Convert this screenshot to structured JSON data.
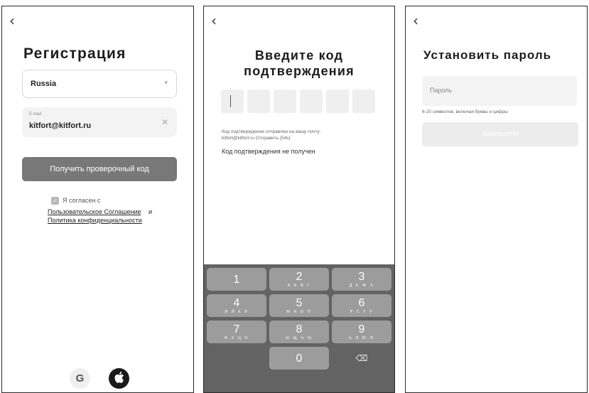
{
  "screen1": {
    "back_icon": "chevron-left-icon",
    "title": "Регистрация",
    "country": "Russia",
    "email_label": "E-mail",
    "email_value": "kitfort@kitfort.ru",
    "get_code_button": "Получить проверочный код",
    "agree_text": "Я согласен с",
    "user_agreement_link": "Пользовательское Соглашение",
    "and_text": "и",
    "privacy_policy_link": "Политика конфиденциальности",
    "google_icon_glyph": "G",
    "apple_icon": "apple-icon"
  },
  "screen2": {
    "back_icon": "chevron-left-icon",
    "title_line1": "Введите код",
    "title_line2": "подтверждения",
    "code_digits": 6,
    "sent_line1": "Код подтверждения отправлен на вашу почту:",
    "sent_line2": "kitfort@kitfort.ru Отправить (54s)",
    "not_received": "Код подтверждения не получен",
    "keys": [
      {
        "num": "1",
        "letters": ""
      },
      {
        "num": "2",
        "letters": "А Б В Г"
      },
      {
        "num": "3",
        "letters": "Д Е Ж З"
      },
      {
        "num": "4",
        "letters": "И Й К Л"
      },
      {
        "num": "5",
        "letters": "М Н О П"
      },
      {
        "num": "6",
        "letters": "Р С Т У"
      },
      {
        "num": "7",
        "letters": "Ф Х Ц Ч"
      },
      {
        "num": "8",
        "letters": "Ш Щ Ъ Ы"
      },
      {
        "num": "9",
        "letters": "Ь Э Ю Я"
      },
      {
        "num": "0",
        "letters": ""
      }
    ],
    "backspace_icon": "backspace-icon"
  },
  "screen3": {
    "back_icon": "chevron-left-icon",
    "title": "Установить пароль",
    "password_placeholder": "Пароль",
    "hint": "6-20 символов, включая буквы и цифры",
    "done_button": "Завершено"
  },
  "colors": {
    "primary_button": "#787878",
    "disabled_button": "#ececec",
    "keypad_bg": "#636363",
    "key_bg": "#9c9c9c",
    "field_bg": "#f3f3f3"
  }
}
